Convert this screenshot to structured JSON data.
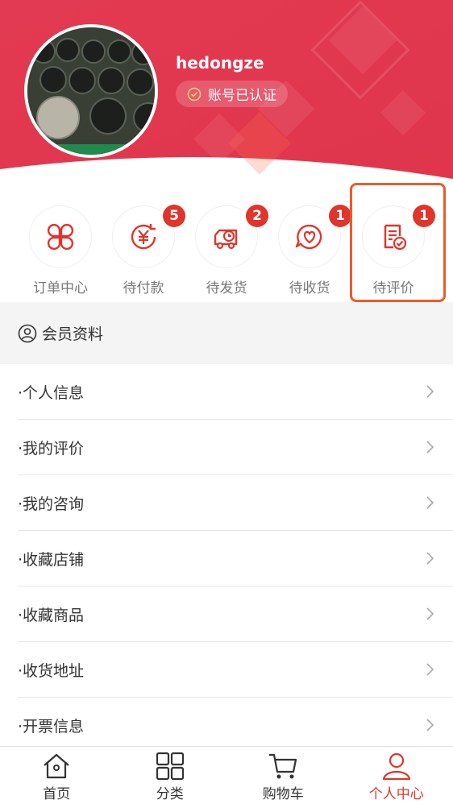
{
  "profile": {
    "username": "hedongze",
    "verified_label": "账号已认证",
    "avatar_icon": "keyboard-photo-avatar"
  },
  "colors": {
    "brand": "#e0352b",
    "highlight": "#f05a28"
  },
  "orders": [
    {
      "label": "订单中心",
      "icon": "clover-icon",
      "badge": ""
    },
    {
      "label": "待付款",
      "icon": "yuan-refresh-icon",
      "badge": "5"
    },
    {
      "label": "待发货",
      "icon": "delivery-truck-icon",
      "badge": "2"
    },
    {
      "label": "待收货",
      "icon": "heart-chat-icon",
      "badge": "1"
    },
    {
      "label": "待评价",
      "icon": "review-document-icon",
      "badge": "1"
    }
  ],
  "member": {
    "title": "会员资料",
    "items": [
      {
        "label": "·个人信息"
      },
      {
        "label": "·我的评价"
      },
      {
        "label": "·我的咨询"
      },
      {
        "label": "·收藏店铺"
      },
      {
        "label": "·收藏商品"
      },
      {
        "label": "·收货地址"
      },
      {
        "label": "·开票信息"
      }
    ]
  },
  "tabs": [
    {
      "label": "首页",
      "icon": "home-icon",
      "active": false
    },
    {
      "label": "分类",
      "icon": "grid-icon",
      "active": false
    },
    {
      "label": "购物车",
      "icon": "cart-icon",
      "active": false
    },
    {
      "label": "个人中心",
      "icon": "person-icon",
      "active": true
    }
  ]
}
